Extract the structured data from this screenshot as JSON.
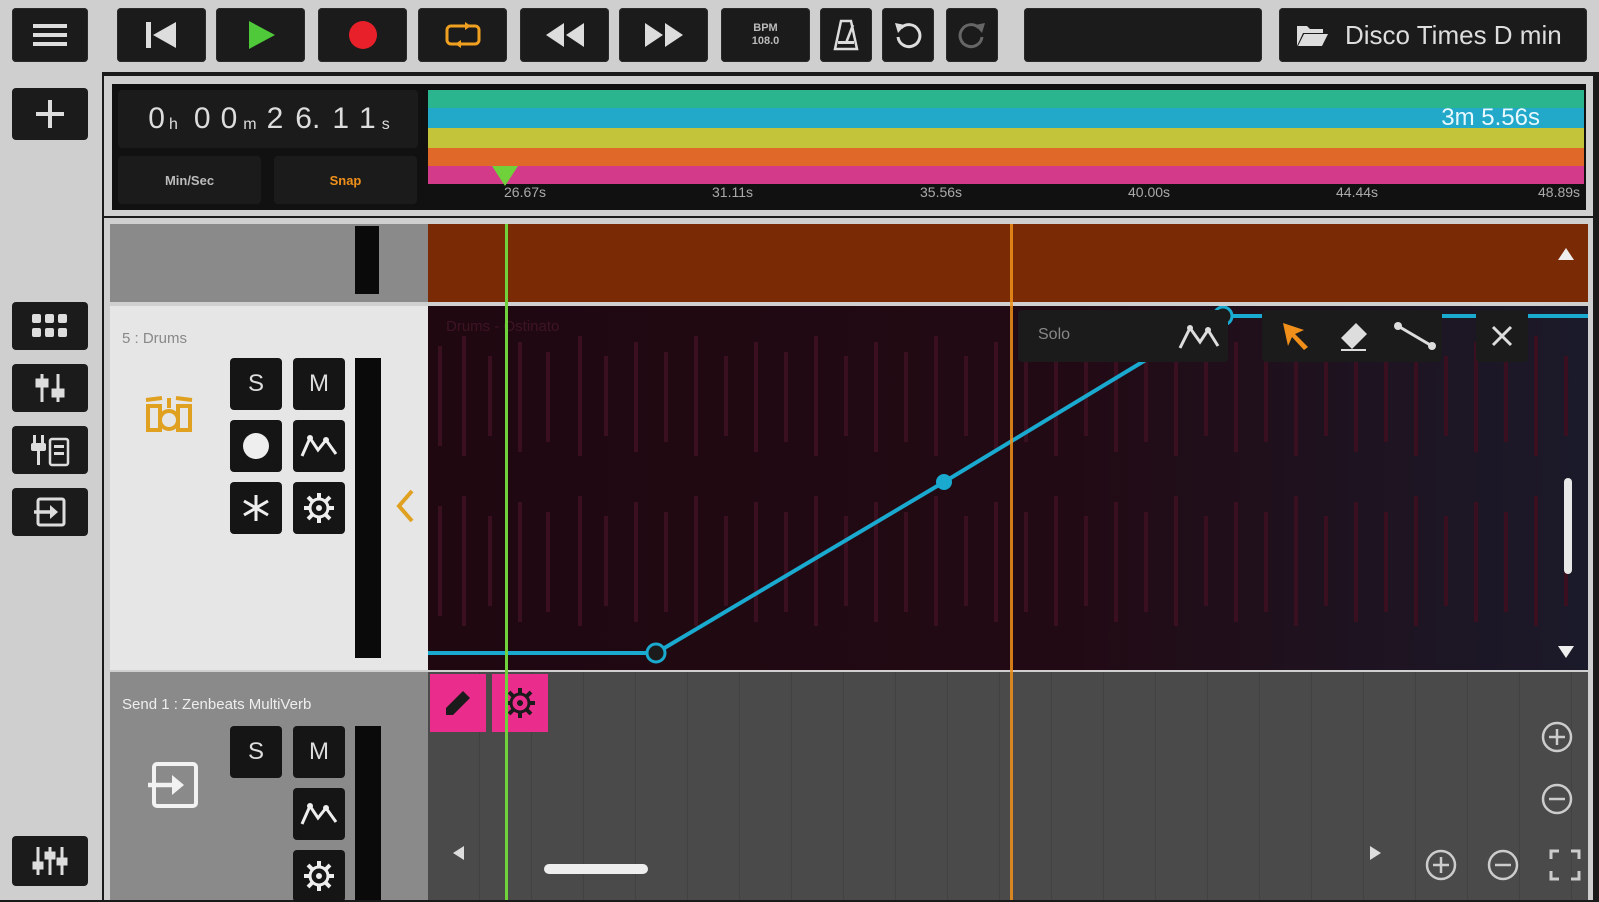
{
  "toolbar": {
    "bpm_label": "BPM",
    "bpm_value": "108.0",
    "project_name": "Disco Times D min"
  },
  "transport": {
    "time": [
      "0",
      "h",
      "0",
      "0",
      "m",
      "2",
      "6.",
      "1",
      "1",
      "s"
    ],
    "min_sec_label": "Min/Sec",
    "snap_label": "Snap",
    "total_length": "3m 5.56s",
    "ruler_ticks": [
      "26.67s",
      "31.11s",
      "35.56s",
      "40.00s",
      "44.44s",
      "48.89s"
    ],
    "overview_colors": [
      "#2bb58e",
      "#22a8c9",
      "#c4c43a",
      "#e0692a",
      "#d43a8a"
    ]
  },
  "tracks": {
    "drums": {
      "name": "5 : Drums",
      "solo": "S",
      "mute": "M",
      "region_name": "Drums - Ostinato",
      "automation_param": "Solo"
    },
    "send": {
      "name": "Send 1 : Zenbeats MultiVerb",
      "solo": "S",
      "mute": "M"
    }
  },
  "colors": {
    "accent_pink": "#ea2c8c",
    "playhead": "#6fd23a",
    "loop_marker": "#f0901a",
    "automation_line": "#1aa9cf",
    "region_bg": "#7a2a05"
  }
}
